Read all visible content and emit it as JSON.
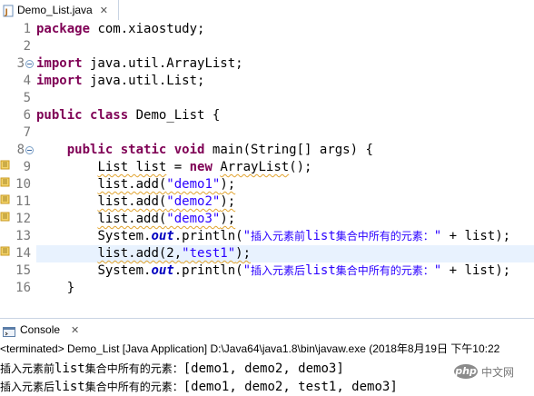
{
  "editor_tab": {
    "label": "Demo_List.java",
    "close": "✕"
  },
  "gutter": {
    "line_numbers": [
      "1",
      "2",
      "3",
      "4",
      "5",
      "6",
      "7",
      "8",
      "9",
      "10",
      "11",
      "12",
      "13",
      "14",
      "15",
      "16"
    ]
  },
  "code": {
    "l1": {
      "kw": "package",
      "rest": " com.xiaostudy;"
    },
    "l3": {
      "kw": "import",
      "rest": " java.util.ArrayList;"
    },
    "l4": {
      "kw": "import",
      "rest": " java.util.List;"
    },
    "l6": {
      "kw1": "public",
      "kw2": "class",
      "rest": " Demo_List {"
    },
    "l8": {
      "indent": "    ",
      "kw1": "public",
      "kw2": "static",
      "kw3": "void",
      "rest": " main(String[] args) {"
    },
    "l9": {
      "indent": "        ",
      "a": "List list",
      "b": " = ",
      "kw": "new",
      "c": " ",
      "d": "ArrayList",
      "e": "();"
    },
    "l10": {
      "indent": "        ",
      "a": "list.add(",
      "str": "\"demo1\"",
      "b": ");"
    },
    "l11": {
      "indent": "        ",
      "a": "list.add(",
      "str": "\"demo2\"",
      "b": ");"
    },
    "l12": {
      "indent": "        ",
      "a": "list.add(",
      "str": "\"demo3\"",
      "b": ");"
    },
    "l13": {
      "indent": "        ",
      "a": "System.",
      "field": "out",
      "b": ".println(",
      "str_q1": "\"",
      "str_cjk1": "插入元素前",
      "str_lat": "list",
      "str_cjk2": "集合中所有的元素：",
      "str_q2": "\"",
      "c": " + list);"
    },
    "l14": {
      "indent": "        ",
      "a": "list.add(2,",
      "str": "\"test1\"",
      "b": ");"
    },
    "l15": {
      "indent": "        ",
      "a": "System.",
      "field": "out",
      "b": ".println(",
      "str_q1": "\"",
      "str_cjk1": "插入元素后",
      "str_lat": "list",
      "str_cjk2": "集合中所有的元素：",
      "str_q2": "\"",
      "c": " + list);"
    },
    "l16": {
      "indent": "    ",
      "a": "}"
    }
  },
  "console": {
    "tab_label": "Console",
    "close": "✕",
    "status": "<terminated> Demo_List [Java Application] D:\\Java64\\java1.8\\bin\\javaw.exe (2018年8月19日 下午10:22",
    "output": [
      {
        "cjk1": "插入元素前",
        "lat": "list",
        "cjk2": "集合中所有的元素：",
        "value": "[demo1, demo2, demo3]"
      },
      {
        "cjk1": "插入元素后",
        "lat": "list",
        "cjk2": "集合中所有的元素：",
        "value": "[demo1, demo2, test1, demo3]"
      }
    ]
  },
  "watermark": {
    "logo": "php",
    "text": "中文网"
  },
  "colors": {
    "keyword": "#7f0055",
    "string": "#2a00ff",
    "field": "#0000c0",
    "line_number": "#787878",
    "current_line": "#e8f2fe",
    "warning": "#e1a32e"
  },
  "icons": {
    "file": "java-file-icon",
    "close": "close-icon",
    "fold": "fold-icon",
    "warning": "warning-marker-icon",
    "console": "console-icon"
  }
}
